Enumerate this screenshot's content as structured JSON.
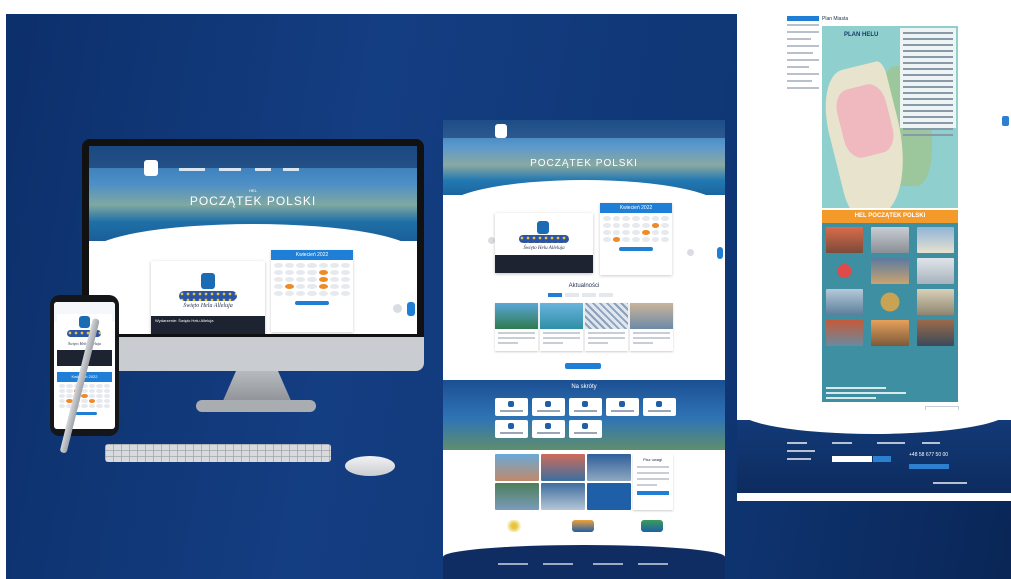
{
  "desktop": {
    "hero_subtitle": "HEL",
    "hero_title": "POCZĄTEK POLSKI",
    "featured_title": "Święto Helu Alleluja",
    "featured_caption": "Wydarzenie: Święto Helu Alleluja",
    "calendar_month": "Kwiecień 2022"
  },
  "phone": {
    "featured_title": "Święto Helu Alleluja",
    "calendar_month": "Kwiecień 2022"
  },
  "mid_page": {
    "hero_title": "POCZĄTEK POLSKI",
    "calendar_month": "Kwiecień 2022",
    "featured_title": "Święto Helu Alleluja",
    "news_title": "Aktualności",
    "band_title": "Na skróty",
    "side_title": "Pisz uwagi"
  },
  "right_page": {
    "section_title": "Plan Miasta",
    "map_label": "PLAN HELU",
    "poster_title": "HEL POCZĄTEK POLSKI",
    "footer_phone": "+48 58 677 50 00"
  },
  "colors": {
    "navy": "#0f3674",
    "accent_blue": "#1f7fd6",
    "orange": "#f08a24"
  }
}
